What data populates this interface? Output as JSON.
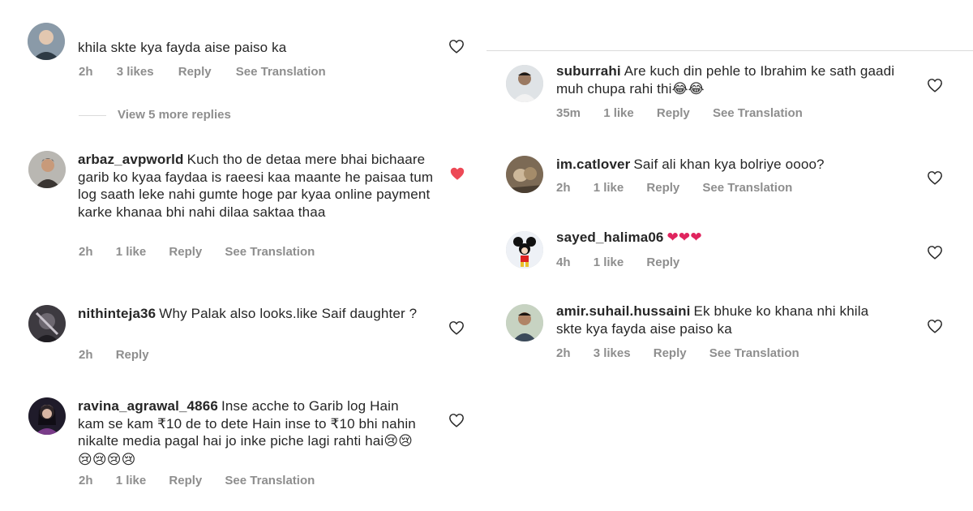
{
  "left": {
    "top_comment_partial": {
      "text": "khila skte kya fayda aise paiso ka",
      "meta": {
        "time": "2h",
        "likes": "3 likes",
        "reply": "Reply",
        "see_translation": "See Translation"
      }
    },
    "view_more_replies": "View 5 more replies",
    "comments": [
      {
        "username": "arbaz_avpworld",
        "text": "Kuch tho de detaa mere bhai bichaare garib ko kyaa faydaa is raeesi kaa maante he paisaa tum log saath leke nahi gumte hoge par kyaa online payment karke khanaa bhi nahi dilaa saktaa thaa",
        "time": "2h",
        "likes": "1 like",
        "reply": "Reply",
        "see_translation": "See Translation",
        "liked": true
      },
      {
        "username": "nithinteja36",
        "text": "Why Palak also looks.like Saif daughter ?",
        "time": "2h",
        "reply": "Reply",
        "liked": false
      },
      {
        "username": "ravina_agrawal_4866",
        "text": "Inse acche to Garib log Hain kam se kam ₹10 de to dete Hain inse to ₹10 bhi nahin nikalte media pagal hai jo inke piche lagi rahti hai",
        "emoji": "😢😢😢😢😢😢",
        "time": "2h",
        "likes": "1 like",
        "reply": "Reply",
        "see_translation": "See Translation",
        "liked": false
      }
    ]
  },
  "right": {
    "comments": [
      {
        "username": "suburrahi",
        "text": "Are kuch din pehle to Ibrahim ke sath gaadi muh chupa rahi thi",
        "emoji": "😂😂",
        "time": "35m",
        "likes": "1 like",
        "reply": "Reply",
        "see_translation": "See Translation"
      },
      {
        "username": "im.catlover",
        "text": "Saif ali khan kya bolriye oooo?",
        "time": "2h",
        "likes": "1 like",
        "reply": "Reply",
        "see_translation": "See Translation"
      },
      {
        "username": "sayed_halima06",
        "text": "",
        "emoji": "❤❤❤",
        "time": "4h",
        "likes": "1 like",
        "reply": "Reply"
      },
      {
        "username": "amir.suhail.hussaini",
        "text": "Ek bhuke ko khana nhi khila skte kya fayda aise paiso ka",
        "time": "2h",
        "likes": "3 likes",
        "reply": "Reply",
        "see_translation": "See Translation"
      }
    ]
  },
  "icons": {
    "heart_outline": "heart-outline-icon",
    "heart_filled": "heart-filled-icon"
  },
  "colors": {
    "text": "#262626",
    "meta": "#8e8e8e",
    "liked_heart": "#ed4956",
    "divider": "#dbdbdb"
  }
}
